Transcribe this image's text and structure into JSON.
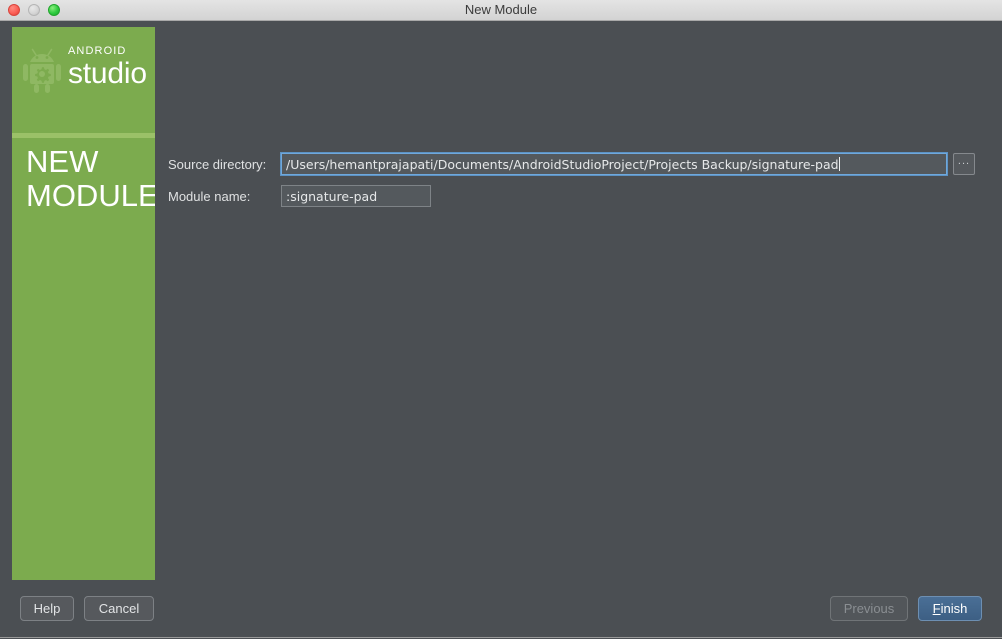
{
  "window": {
    "title": "New Module",
    "traffic_lights": [
      {
        "name": "close",
        "color": "#fb5f56"
      },
      {
        "name": "minimize",
        "color": "#d6d6d6"
      },
      {
        "name": "maximize",
        "color": "#2ecb3f"
      }
    ]
  },
  "sidebar": {
    "brand_top": "ANDROID",
    "brand_bottom": "studio",
    "headline_line1": "NEW",
    "headline_line2": "MODULE",
    "background_color": "#7cab4e",
    "divider_color": "#9bc168"
  },
  "form": {
    "fields": [
      {
        "label": "Source directory:",
        "value": "/Users/hemantprajapati/Documents/AndroidStudioProject/Projects Backup/signature-pad",
        "focused": true,
        "browse_label": "..."
      },
      {
        "label": "Module name:",
        "value": ":signature-pad",
        "focused": false
      }
    ]
  },
  "footer": {
    "help_label": "Help",
    "cancel_label": "Cancel",
    "previous_label": "Previous",
    "finish_label": "Finish",
    "finish_mnemonic": "F",
    "finish_rest": "inish",
    "previous_enabled": false,
    "finish_is_default": true,
    "default_button_color": "#44658c"
  }
}
